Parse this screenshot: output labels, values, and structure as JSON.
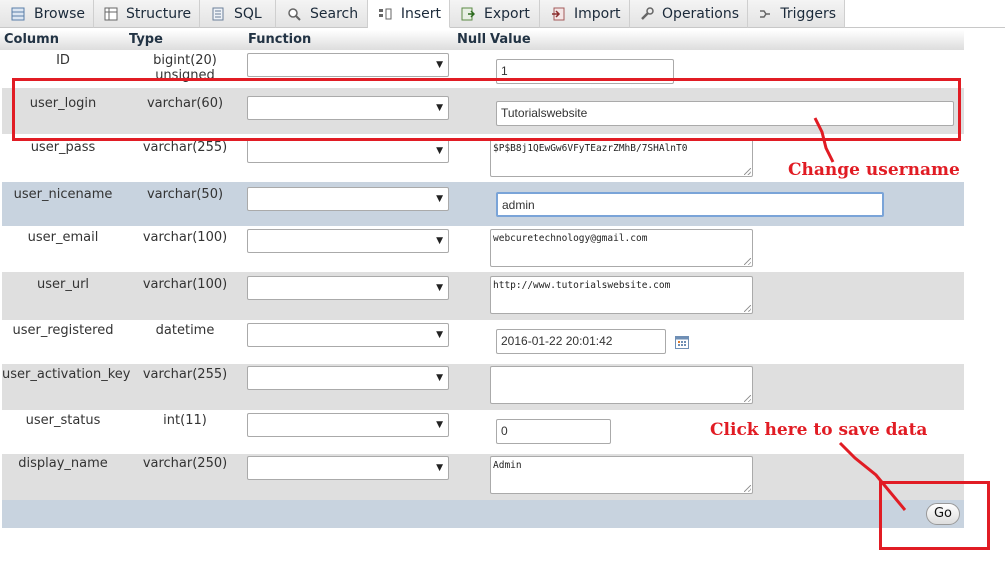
{
  "tabs": [
    {
      "label": "Browse",
      "icon": "browse-icon"
    },
    {
      "label": "Structure",
      "icon": "structure-icon"
    },
    {
      "label": "SQL",
      "icon": "sql-icon"
    },
    {
      "label": "Search",
      "icon": "search-icon"
    },
    {
      "label": "Insert",
      "icon": "insert-icon",
      "active": true
    },
    {
      "label": "Export",
      "icon": "export-icon"
    },
    {
      "label": "Import",
      "icon": "import-icon"
    },
    {
      "label": "Operations",
      "icon": "wrench-icon"
    },
    {
      "label": "Triggers",
      "icon": "triggers-icon"
    }
  ],
  "table_headers": {
    "column": "Column",
    "type": "Type",
    "function": "Function",
    "null": "Null",
    "value": "Value"
  },
  "rows": [
    {
      "name": "ID",
      "type": "bigint(20) unsigned",
      "value": "1"
    },
    {
      "name": "user_login",
      "type": "varchar(60)",
      "value": "Tutorialswebsite"
    },
    {
      "name": "user_pass",
      "type": "varchar(255)",
      "value": "$P$B8j1QEwGw6VFyTEazrZMhB/7SHAlnT0"
    },
    {
      "name": "user_nicename",
      "type": "varchar(50)",
      "value": "admin"
    },
    {
      "name": "user_email",
      "type": "varchar(100)",
      "value": "webcuretechnology@gmail.com"
    },
    {
      "name": "user_url",
      "type": "varchar(100)",
      "value": "http://www.tutorialswebsite.com"
    },
    {
      "name": "user_registered",
      "type": "datetime",
      "value": "2016-01-22 20:01:42"
    },
    {
      "name": "user_activation_key",
      "type": "varchar(255)",
      "value": ""
    },
    {
      "name": "user_status",
      "type": "int(11)",
      "value": "0"
    },
    {
      "name": "display_name",
      "type": "varchar(250)",
      "value": "Admin"
    }
  ],
  "go_button": "Go",
  "annotations": {
    "change_username": "Change username",
    "save_data": "Click here to save data"
  },
  "colors": {
    "annotation": "#e11c24",
    "row_alt": "#dfdfdf",
    "row_highlight": "#c8d3df"
  }
}
